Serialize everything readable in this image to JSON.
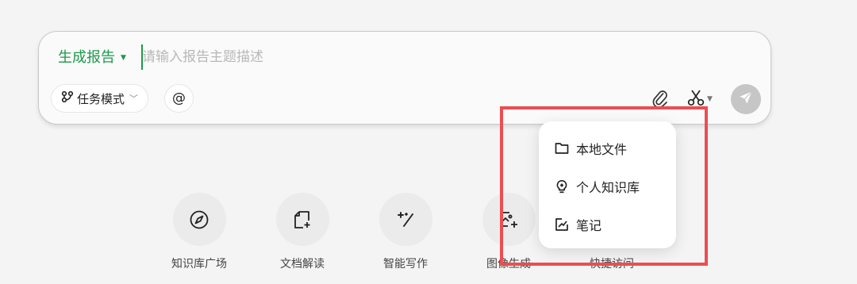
{
  "composer": {
    "mode_label": "生成报告",
    "input_placeholder": "请输入报告主题描述",
    "input_value": "",
    "task_mode_label": "任务模式",
    "at_label": "@",
    "accent_color": "#1a9a4b"
  },
  "icons": {
    "attach": "paperclip-icon",
    "screenshot": "scissors-icon",
    "send": "send-icon",
    "task_mode": "task-flow-icon"
  },
  "shortcuts": [
    {
      "label": "知识库广场",
      "icon": "compass-icon"
    },
    {
      "label": "文档解读",
      "icon": "document-spark-icon"
    },
    {
      "label": "智能写作",
      "icon": "magic-pen-icon"
    },
    {
      "label": "图像生成",
      "icon": "image-spark-icon"
    },
    {
      "label": "快捷访问",
      "icon": "shortcut-icon"
    }
  ],
  "upload_menu": {
    "items": [
      {
        "label": "本地文件",
        "icon": "folder-icon"
      },
      {
        "label": "个人知识库",
        "icon": "lightbulb-icon"
      },
      {
        "label": "笔记",
        "icon": "note-icon"
      }
    ]
  },
  "highlight_color": "#ec4e52"
}
